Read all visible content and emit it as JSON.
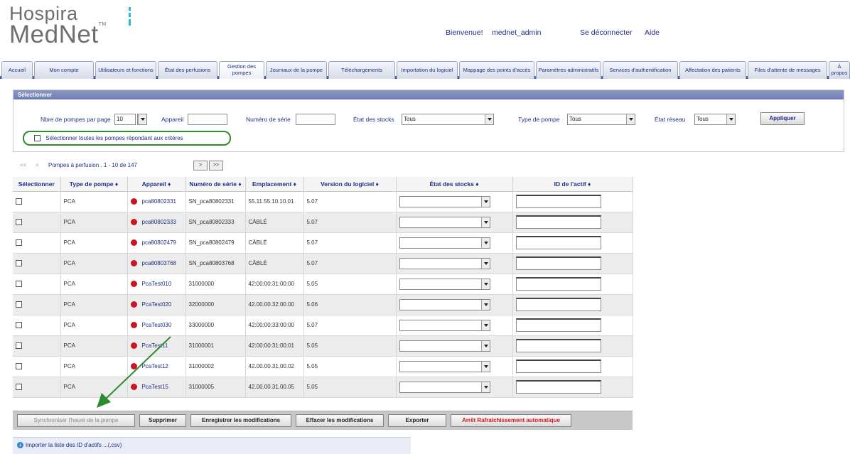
{
  "header": {
    "logo_line1": "Hospira",
    "logo_line2": "MedNet",
    "logo_tm": "TM",
    "welcome": "Bienvenue!",
    "username": "mednet_admin",
    "logout": "Se déconnecter",
    "help": "Aide"
  },
  "tabs": [
    {
      "label": "Accueil"
    },
    {
      "label": "Mon compte"
    },
    {
      "label": "Utilisateurs et fonctions"
    },
    {
      "label": "État des perfusions"
    },
    {
      "label": "Gestion des pompes"
    },
    {
      "label": "Journaux de la pompe"
    },
    {
      "label": "Téléchargements"
    },
    {
      "label": "Importation du logiciel"
    },
    {
      "label": "Mappage des points d'accès"
    },
    {
      "label": "Paramètres administratifs"
    },
    {
      "label": "Services d'authentification"
    },
    {
      "label": "Affectation des patients"
    },
    {
      "label": "Files d'attente de messages"
    },
    {
      "label": "À propos"
    }
  ],
  "filter": {
    "title": "Sélectionner",
    "pumps_per_page_label": "Nbre de pompes par page",
    "pumps_per_page_value": "10",
    "device_label": "Appareil",
    "device_value": "",
    "serial_label": "Numéro de série",
    "serial_value": "",
    "stock_label": "État des stocks",
    "stock_value": "Tous",
    "pump_type_label": "Type de pompe",
    "pump_type_value": "Tous",
    "network_label": "État réseau",
    "network_value": "Tous",
    "apply_button": "Appliquer",
    "select_all_label": "Sélectionner toutes les pompes répondant aux critères"
  },
  "pager": {
    "first": "<<",
    "prev": "<",
    "summary": "Pompes à perfusion . 1 - 10 de 147",
    "next": ">",
    "last": ">>"
  },
  "table": {
    "columns": [
      "Sélectionner",
      "Type de pompe ♦",
      "Appareil ♦",
      "Numéro de série ♦",
      "Emplacement ♦",
      "Version du logiciel ♦",
      "État des stocks ♦",
      "ID de l'actif ♦"
    ],
    "rows": [
      {
        "type": "PCA",
        "device": "pca80802331",
        "serial": "SN_pca80802331",
        "location": "55.11.55.10.10.01",
        "version": "5.07"
      },
      {
        "type": "PCA",
        "device": "pca80802333",
        "serial": "SN_pca80802333",
        "location": "CÂBLÉ",
        "version": "5.07"
      },
      {
        "type": "PCA",
        "device": "pca80802479",
        "serial": "SN_pca80802479",
        "location": "CÂBLÉ",
        "version": "5.07"
      },
      {
        "type": "PCA",
        "device": "pca80803768",
        "serial": "SN_pca80803768",
        "location": "CÂBLÉ",
        "version": "5.07"
      },
      {
        "type": "PCA",
        "device": "PcaTest010",
        "serial": "31000000",
        "location": "42:00:00:31:00:00",
        "version": "5.05"
      },
      {
        "type": "PCA",
        "device": "PcaTest020",
        "serial": "32000000",
        "location": "42.00.00.32.00.00",
        "version": "5.06"
      },
      {
        "type": "PCA",
        "device": "PcaTest030",
        "serial": "33000000",
        "location": "42:00:00:33:00:00",
        "version": "5.07"
      },
      {
        "type": "PCA",
        "device": "PcaTest11",
        "serial": "31000001",
        "location": "42:00:00:31:00:01",
        "version": "5.05"
      },
      {
        "type": "PCA",
        "device": "PcaTest12",
        "serial": "31000002",
        "location": "42.00.00.31.00.02",
        "version": "5.05"
      },
      {
        "type": "PCA",
        "device": "PcaTest15",
        "serial": "31000005",
        "location": "42.00.00.31.00.05",
        "version": "5.05"
      }
    ]
  },
  "actions": {
    "sync": "Synchroniser l'heure de la pompe",
    "delete": "Supprimer",
    "save": "Enregistrer les modifications",
    "clear": "Effacer les modifications",
    "export": "Exporter",
    "stop_refresh": "Arrêt Rafraîchissement automatique"
  },
  "import_link": "Importer la liste des ID d'actifs ...(.csv)",
  "colors": {
    "link_blue": "#1f2e86",
    "status_red": "#cc1422",
    "annotation_green": "#2e8b2e",
    "panel_head": "#7482ba",
    "stop_red": "#d4151b"
  }
}
